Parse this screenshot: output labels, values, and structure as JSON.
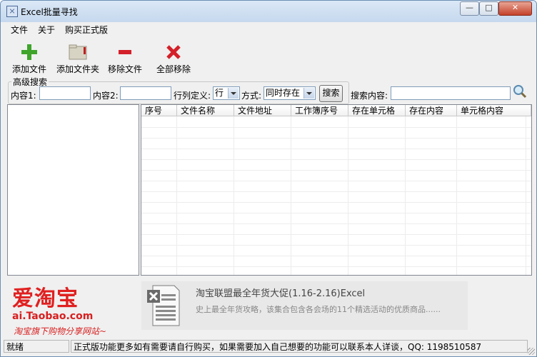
{
  "window": {
    "title": "Excel批量寻找",
    "controls": {
      "minimize": "—",
      "maximize": "□",
      "close": "✕"
    }
  },
  "menu": [
    "文件",
    "关于",
    "购买正式版"
  ],
  "toolbar": [
    {
      "label": "添加文件",
      "icon": "plus-icon"
    },
    {
      "label": "添加文件夹",
      "icon": "folder-icon"
    },
    {
      "label": "移除文件",
      "icon": "minus-icon"
    },
    {
      "label": "全部移除",
      "icon": "x-icon"
    }
  ],
  "advanced_search": {
    "group_title": "高级搜索",
    "content1_label": "内容1:",
    "content1_value": "",
    "content2_label": "内容2:",
    "content2_value": "",
    "rowcol_label": "行列定义:",
    "rowcol_value": "行",
    "mode_label": "方式:",
    "mode_value": "同时存在",
    "search_button": "搜索"
  },
  "search_content": {
    "label": "搜索内容:",
    "value": ""
  },
  "grid": {
    "columns": [
      "序号",
      "文件名称",
      "文件地址",
      "工作簿序号",
      "存在单元格",
      "存在内容",
      "单元格内容"
    ]
  },
  "promo": {
    "logo_main": "爱淘宝",
    "logo_domain": "ai.Taobao.com",
    "slogan": "淘宝旗下购物分享网站~",
    "title": "淘宝联盟最全年货大促(1.16-2.16)Excel",
    "description": "史上最全年货攻略，该集合包含各会场的11个精选活动的优质商品......"
  },
  "statusbar": {
    "state": "就绪",
    "message": "正式版功能更多如有需要请自行购买，如果需要加入自己想要的功能可以联系本人详谈，QQ: 1198510587"
  },
  "colors": {
    "accent_red": "#e02020",
    "plus_green": "#3ea52a",
    "x_red": "#d4202a"
  }
}
